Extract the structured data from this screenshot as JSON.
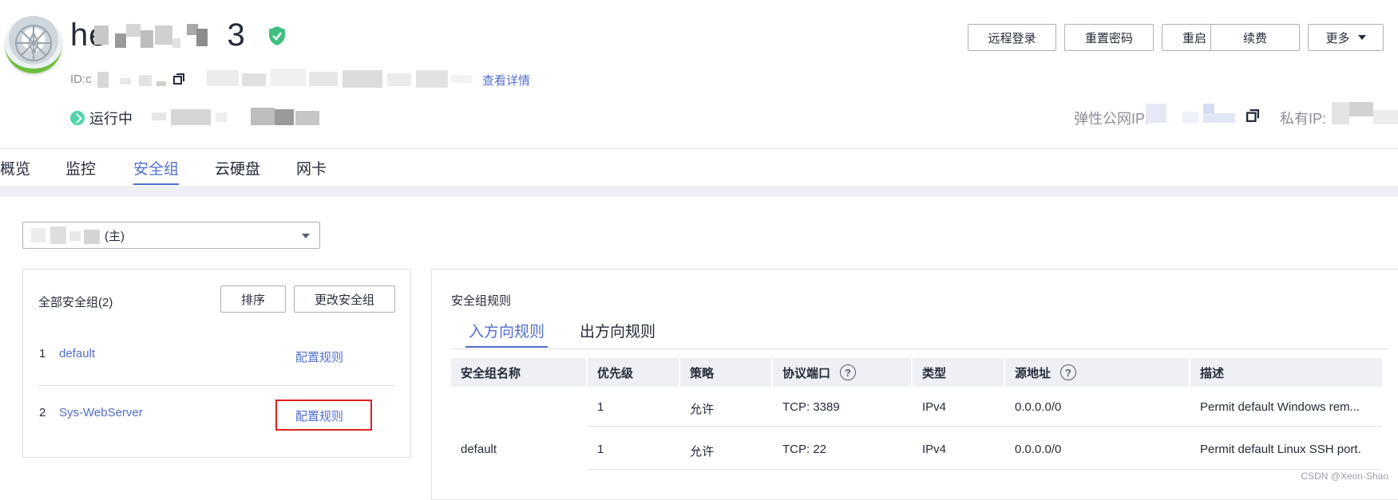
{
  "header": {
    "instance_name_visible_start": "he",
    "instance_name_visible_end": "3",
    "id_prefix": "ID:c",
    "view_details": "查看详情",
    "status": "运行中",
    "eip_label": "弹性公网IP:",
    "private_ip_label": "私有IP:",
    "actions": [
      "远程登录",
      "重置密码",
      "重启",
      "续费",
      "更多"
    ]
  },
  "tabs": [
    {
      "label": "概览",
      "active": false
    },
    {
      "label": "监控",
      "active": false
    },
    {
      "label": "安全组",
      "active": true
    },
    {
      "label": "云硬盘",
      "active": false
    },
    {
      "label": "网卡",
      "active": false
    }
  ],
  "sg_select": {
    "suffix": "(主)"
  },
  "left_panel": {
    "title": "全部安全组(2)",
    "sort_button": "排序",
    "change_button": "更改安全组",
    "groups": [
      {
        "index": "1",
        "name": "default",
        "action": "配置规则"
      },
      {
        "index": "2",
        "name": "Sys-WebServer",
        "action": "配置规则"
      }
    ]
  },
  "right_panel": {
    "title": "安全组规则",
    "subtabs": [
      {
        "label": "入方向规则",
        "active": true
      },
      {
        "label": "出方向规则",
        "active": false
      }
    ],
    "columns": [
      "安全组名称",
      "优先级",
      "策略",
      "协议端口",
      "类型",
      "源地址",
      "描述"
    ],
    "group_cell": "default",
    "rows": [
      {
        "priority": "1",
        "policy": "允许",
        "port": "TCP: 3389",
        "type": "IPv4",
        "source": "0.0.0.0/0",
        "desc": "Permit default Windows rem..."
      },
      {
        "priority": "1",
        "policy": "允许",
        "port": "TCP: 22",
        "type": "IPv4",
        "source": "0.0.0.0/0",
        "desc": "Permit default Linux SSH port."
      }
    ]
  },
  "watermark": "CSDN @Xeon-Shao",
  "colors": {
    "accent": "#526ecc",
    "running": "#50d4ab",
    "highlight": "#e02020",
    "shield": "#3fbf7f"
  }
}
